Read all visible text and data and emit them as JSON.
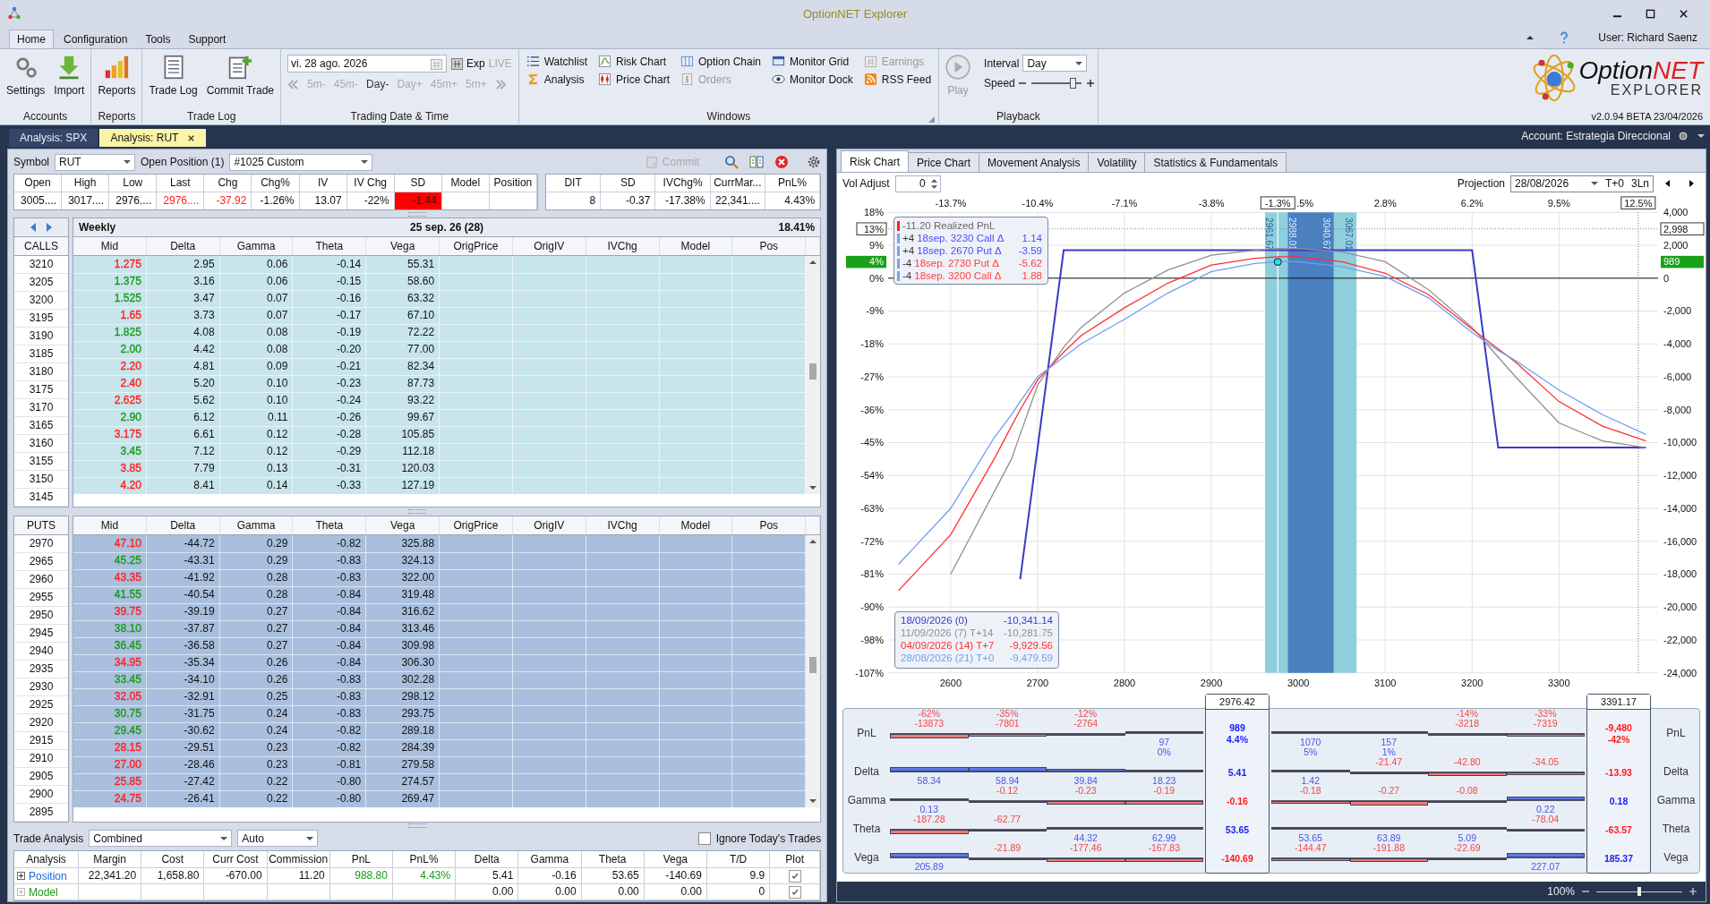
{
  "window": {
    "title": "OptionNET Explorer"
  },
  "menu_tabs": [
    {
      "label": "Home",
      "selected": true
    },
    {
      "label": "Configuration",
      "selected": false
    },
    {
      "label": "Tools",
      "selected": false
    },
    {
      "label": "Support",
      "selected": false
    }
  ],
  "user": "User: Richard Saenz",
  "ribbon": {
    "groups": [
      {
        "title": "Accounts",
        "kind": "large",
        "buttons": [
          {
            "label": "Settings",
            "kind": "gears",
            "disabled": false
          },
          {
            "label": "Import",
            "kind": "import",
            "disabled": false
          }
        ]
      },
      {
        "title": "Reports",
        "kind": "large",
        "buttons": [
          {
            "label": "Reports",
            "kind": "bars",
            "disabled": false
          }
        ]
      },
      {
        "title": "Trade Log",
        "kind": "large",
        "buttons": [
          {
            "label": "Trade Log",
            "kind": "document",
            "disabled": false
          },
          {
            "label": "Commit Trade",
            "kind": "document-plus",
            "disabled": false
          }
        ]
      },
      {
        "title": "Trading Date & Time",
        "kind": "date",
        "date": "vi. 28 ago. 2026",
        "exp": "Exp",
        "live": {
          "label": "LIVE",
          "on": false
        },
        "steps": [
          {
            "label": "5m-",
            "disabled": true
          },
          {
            "label": "45m-",
            "disabled": true
          },
          {
            "label": "Day-",
            "disabled": false
          },
          {
            "label": "Day+",
            "disabled": true
          },
          {
            "label": "45m+",
            "disabled": true
          },
          {
            "label": "5m+",
            "disabled": true
          }
        ]
      },
      {
        "title": "Windows",
        "kind": "small",
        "buttons": [
          {
            "label": "Watchlist",
            "kind": "list",
            "disabled": false
          },
          {
            "label": "Risk Chart",
            "kind": "line-chart",
            "disabled": false
          },
          {
            "label": "Option Chain",
            "kind": "columns",
            "disabled": false
          },
          {
            "label": "Monitor Grid",
            "kind": "monitor",
            "disabled": false
          },
          {
            "label": "Earnings",
            "kind": "calendar",
            "disabled": true
          },
          {
            "label": "Analysis",
            "kind": "sigma",
            "disabled": false
          },
          {
            "label": "Price Chart",
            "kind": "candle",
            "disabled": false
          },
          {
            "label": "Orders",
            "kind": "dollar",
            "disabled": true
          },
          {
            "label": "Monitor Dock",
            "kind": "eye",
            "disabled": false
          },
          {
            "label": "RSS Feed",
            "kind": "rss",
            "disabled": false
          }
        ]
      },
      {
        "title": "Playback",
        "kind": "playback",
        "play": {
          "label": "Play",
          "disabled": true
        },
        "interval_label": "Interval",
        "interval": "Day",
        "speed_label": "Speed",
        "speed": {
          "level": 0.85
        }
      }
    ],
    "logo": {
      "first": "Option",
      "second": "NET",
      "sub": "EXPLORER"
    },
    "version": "v2.0.94 BETA 23/04/2026"
  },
  "doc_tabs": [
    {
      "label": "Analysis: SPX",
      "selected": false
    },
    {
      "label": "Analysis: RUT",
      "selected": true
    }
  ],
  "account": "Account: Estrategia Direccional",
  "left": {
    "symbol_label": "Symbol",
    "symbol": "RUT",
    "position_label": "Open Position (1)",
    "position": "#1025 Custom",
    "commit": {
      "label": "Commit",
      "disabled": true
    },
    "quote": [
      {
        "label": "Open",
        "value": "3005....",
        "kind": "normal"
      },
      {
        "label": "High",
        "value": "3017....",
        "kind": "normal"
      },
      {
        "label": "Low",
        "value": "2976....",
        "kind": "normal"
      },
      {
        "label": "Last",
        "value": "2976....",
        "kind": "negative"
      },
      {
        "label": "Chg",
        "value": "-37.92",
        "kind": "negative"
      },
      {
        "label": "Chg%",
        "value": "-1.26%",
        "kind": "normal"
      },
      {
        "label": "IV",
        "value": "13.07",
        "kind": "normal"
      },
      {
        "label": "IV Chg",
        "value": "-22%",
        "kind": "normal"
      },
      {
        "label": "SD",
        "value": "-1.44",
        "kind": "alert"
      },
      {
        "label": "Model",
        "kind": "normal"
      },
      {
        "label": "Position",
        "kind": "normal"
      }
    ],
    "stats": [
      {
        "label": "DIT",
        "value": "8"
      },
      {
        "label": "SD",
        "value": "-0.37"
      },
      {
        "label": "IVChg%",
        "value": "-17.38%"
      },
      {
        "label": "CurrMar...",
        "value": "22,341...."
      },
      {
        "label": "PnL%",
        "value": "4.43%"
      }
    ],
    "chain": {
      "series": "Weekly",
      "expiry": "25 sep. 26 (28)",
      "iv": "18.41%",
      "calls": {
        "label": "CALLS",
        "columns": [
          "Mid",
          "Delta",
          "Gamma",
          "Theta",
          "Vega",
          "OrigPrice",
          "OrigIV",
          "IVChg",
          "Model",
          "Pos"
        ],
        "rows": [
          {
            "strike": "3210",
            "mid": "1.275",
            "color": "#ff2020",
            "delta": "2.95",
            "gamma": "0.06",
            "theta": "-0.14",
            "vega": "55.31"
          },
          {
            "strike": "3205",
            "mid": "1.375",
            "color": "#1a9a1a",
            "delta": "3.16",
            "gamma": "0.06",
            "theta": "-0.15",
            "vega": "58.60"
          },
          {
            "strike": "3200",
            "mid": "1.525",
            "color": "#1a9a1a",
            "delta": "3.47",
            "gamma": "0.07",
            "theta": "-0.16",
            "vega": "63.32"
          },
          {
            "strike": "3195",
            "mid": "1.65",
            "color": "#ff2020",
            "delta": "3.73",
            "gamma": "0.07",
            "theta": "-0.17",
            "vega": "67.10"
          },
          {
            "strike": "3190",
            "mid": "1.825",
            "color": "#1a9a1a",
            "delta": "4.08",
            "gamma": "0.08",
            "theta": "-0.19",
            "vega": "72.22"
          },
          {
            "strike": "3185",
            "mid": "2.00",
            "color": "#1a9a1a",
            "delta": "4.42",
            "gamma": "0.08",
            "theta": "-0.20",
            "vega": "77.00"
          },
          {
            "strike": "3180",
            "mid": "2.20",
            "color": "#ff2020",
            "delta": "4.81",
            "gamma": "0.09",
            "theta": "-0.21",
            "vega": "82.34"
          },
          {
            "strike": "3175",
            "mid": "2.40",
            "color": "#ff2020",
            "delta": "5.20",
            "gamma": "0.10",
            "theta": "-0.23",
            "vega": "87.73"
          },
          {
            "strike": "3170",
            "mid": "2.625",
            "color": "#ff2020",
            "delta": "5.62",
            "gamma": "0.10",
            "theta": "-0.24",
            "vega": "93.22"
          },
          {
            "strike": "3165",
            "mid": "2.90",
            "color": "#1a9a1a",
            "delta": "6.12",
            "gamma": "0.11",
            "theta": "-0.26",
            "vega": "99.67"
          },
          {
            "strike": "3160",
            "mid": "3.175",
            "color": "#ff2020",
            "delta": "6.61",
            "gamma": "0.12",
            "theta": "-0.28",
            "vega": "105.85"
          },
          {
            "strike": "3155",
            "mid": "3.45",
            "color": "#1a9a1a",
            "delta": "7.12",
            "gamma": "0.12",
            "theta": "-0.29",
            "vega": "112.18"
          },
          {
            "strike": "3150",
            "mid": "3.85",
            "color": "#ff2020",
            "delta": "7.79",
            "gamma": "0.13",
            "theta": "-0.31",
            "vega": "120.03"
          },
          {
            "strike": "3145",
            "mid": "4.20",
            "color": "#ff2020",
            "delta": "8.41",
            "gamma": "0.14",
            "theta": "-0.33",
            "vega": "127.19"
          }
        ]
      },
      "puts": {
        "label": "PUTS",
        "columns": [
          "Mid",
          "Delta",
          "Gamma",
          "Theta",
          "Vega",
          "OrigPrice",
          "OrigIV",
          "IVChg",
          "Model",
          "Pos"
        ],
        "rows": [
          {
            "strike": "2970",
            "mid": "47.10",
            "color": "#ff2020",
            "delta": "-44.72",
            "gamma": "0.29",
            "theta": "-0.82",
            "vega": "325.88"
          },
          {
            "strike": "2965",
            "mid": "45.25",
            "color": "#1a9a1a",
            "delta": "-43.31",
            "gamma": "0.29",
            "theta": "-0.83",
            "vega": "324.13"
          },
          {
            "strike": "2960",
            "mid": "43.35",
            "color": "#ff2020",
            "delta": "-41.92",
            "gamma": "0.28",
            "theta": "-0.83",
            "vega": "322.00"
          },
          {
            "strike": "2955",
            "mid": "41.55",
            "color": "#1a9a1a",
            "delta": "-40.54",
            "gamma": "0.28",
            "theta": "-0.84",
            "vega": "319.48"
          },
          {
            "strike": "2950",
            "mid": "39.75",
            "color": "#ff2020",
            "delta": "-39.19",
            "gamma": "0.27",
            "theta": "-0.84",
            "vega": "316.62"
          },
          {
            "strike": "2945",
            "mid": "38.10",
            "color": "#1a9a1a",
            "delta": "-37.87",
            "gamma": "0.27",
            "theta": "-0.84",
            "vega": "313.46"
          },
          {
            "strike": "2940",
            "mid": "36.45",
            "color": "#1a9a1a",
            "delta": "-36.58",
            "gamma": "0.27",
            "theta": "-0.84",
            "vega": "309.98"
          },
          {
            "strike": "2935",
            "mid": "34.95",
            "color": "#ff2020",
            "delta": "-35.34",
            "gamma": "0.26",
            "theta": "-0.84",
            "vega": "306.30"
          },
          {
            "strike": "2930",
            "mid": "33.45",
            "color": "#1a9a1a",
            "delta": "-34.10",
            "gamma": "0.26",
            "theta": "-0.83",
            "vega": "302.28"
          },
          {
            "strike": "2925",
            "mid": "32.05",
            "color": "#ff2020",
            "delta": "-32.91",
            "gamma": "0.25",
            "theta": "-0.83",
            "vega": "298.12"
          },
          {
            "strike": "2920",
            "mid": "30.75",
            "color": "#1a9a1a",
            "delta": "-31.75",
            "gamma": "0.24",
            "theta": "-0.83",
            "vega": "293.75"
          },
          {
            "strike": "2915",
            "mid": "29.45",
            "color": "#1a9a1a",
            "delta": "-30.62",
            "gamma": "0.24",
            "theta": "-0.82",
            "vega": "289.18"
          },
          {
            "strike": "2910",
            "mid": "28.15",
            "color": "#ff2020",
            "delta": "-29.51",
            "gamma": "0.23",
            "theta": "-0.82",
            "vega": "284.39"
          },
          {
            "strike": "2905",
            "mid": "27.00",
            "color": "#ff2020",
            "delta": "-28.46",
            "gamma": "0.23",
            "theta": "-0.81",
            "vega": "279.58"
          },
          {
            "strike": "2900",
            "mid": "25.85",
            "color": "#ff2020",
            "delta": "-27.42",
            "gamma": "0.22",
            "theta": "-0.80",
            "vega": "274.57"
          },
          {
            "strike": "2895",
            "mid": "24.75",
            "color": "#ff2020",
            "delta": "-26.41",
            "gamma": "0.22",
            "theta": "-0.80",
            "vega": "269.47"
          }
        ]
      }
    },
    "trade_analysis": {
      "label": "Trade Analysis",
      "mode": "Combined",
      "scale": "Auto",
      "ignore": {
        "label": "Ignore Today's Trades",
        "checked": false
      },
      "columns": [
        "Analysis",
        "Margin",
        "Cost",
        "Curr Cost",
        "Commission",
        "PnL",
        "PnL%",
        "Delta",
        "Gamma",
        "Theta",
        "Vega",
        "T/D",
        "Plot"
      ],
      "rows": [
        {
          "color": "#1a6ad0",
          "cells": [
            "Position",
            "22,341.20",
            "1,658.80",
            "-670.00",
            "11.20",
            "988.80",
            "4.43%",
            "5.41",
            "-0.16",
            "53.65",
            "-140.69",
            "9.9"
          ],
          "plot": true
        },
        {
          "color": "#1a9a1a",
          "cells": [
            "Model",
            null,
            null,
            null,
            null,
            null,
            null,
            "0.00",
            "0.00",
            "0.00",
            "0.00",
            "0"
          ],
          "plot": true
        }
      ]
    }
  },
  "right": {
    "chart_tabs": [
      {
        "label": "Risk Chart",
        "selected": true
      },
      {
        "label": "Price Chart",
        "selected": false
      },
      {
        "label": "Movement Analysis",
        "selected": false
      },
      {
        "label": "Volatility",
        "selected": false
      },
      {
        "label": "Statistics & Fundamentals",
        "selected": false
      }
    ],
    "vol_adjust": {
      "label": "Vol Adjust",
      "value": "0"
    },
    "projection": {
      "label": "Projection",
      "date": "28/08/2026",
      "offset": "T+0",
      "lines": "3Ln"
    },
    "risk_chart": {
      "top_axis_labels": [
        "-13.7%",
        "-10.4%",
        "-7.1%",
        "-3.8%",
        ".5%",
        "2.8%",
        "6.2%",
        "9.5%"
      ],
      "percent_ticks": [
        "18%",
        "9%",
        "0%",
        "-9%",
        "-18%",
        "-27%",
        "-36%",
        "-45%",
        "-54%",
        "-63%",
        "-72%",
        "-81%",
        "-90%",
        "-98%",
        "-107%"
      ],
      "current_pnl": {
        "percent": "4%",
        "value": "989"
      },
      "level_percent": "13%",
      "cursor_percents": [
        "-1.3%",
        "12.5%"
      ],
      "band_labels": [
        "2961.67",
        "2988.01",
        "3040.67",
        "3067.01"
      ],
      "legend": {
        "realized": "-11.20 Realized PnL",
        "legs": [
          {
            "qty": "+4",
            "name": "18sep. 3230 Call Δ",
            "delta": "1.14",
            "color": "#4a4aff"
          },
          {
            "qty": "+4",
            "name": "18sep. 2670 Put Δ",
            "delta": "-3.59",
            "color": "#4a4aff"
          },
          {
            "qty": "-4",
            "name": "18sep. 2730 Put Δ",
            "delta": "-5.62",
            "color": "#ff4040"
          },
          {
            "qty": "-4",
            "name": "18sep. 3200 Call Δ",
            "delta": "1.88",
            "color": "#ff4040"
          }
        ]
      },
      "tooltip": [
        {
          "value": "-10,341.14"
        },
        {
          "value": "-10,281.75"
        },
        {
          "value": "-9,929.56"
        },
        {
          "value": "-9,479.59"
        }
      ],
      "chart_data": {
        "type": "line",
        "grid": true,
        "x": [
          2540,
          2600,
          2650,
          2670,
          2680,
          2700,
          2730,
          2750,
          2800,
          2850,
          2900,
          2950,
          2976,
          3000,
          3050,
          3100,
          3150,
          3200,
          3230,
          3250,
          3300,
          3350,
          3400
        ],
        "xlim": [
          2528,
          3414
        ],
        "ylim": [
          -24000,
          4000
        ],
        "bands": [
          {
            "axis": "x",
            "from": 2961.67,
            "to": 3067.01
          },
          {
            "axis": "x",
            "from": 2988.01,
            "to": 3040.67
          }
        ],
        "ref_lines": [
          {
            "axis": "y",
            "value": 2998,
            "label": "2,998"
          },
          {
            "axis": "x",
            "value": 2976.42,
            "label": "2976.42"
          },
          {
            "axis": "x",
            "value": 3391.17,
            "label": "3391.17"
          }
        ],
        "xticks": [
          2600,
          2700,
          2800,
          2900,
          3000,
          3100,
          3200,
          3300
        ],
        "yticks": [
          {
            "value": 4000,
            "label": "4,000"
          },
          {
            "value": 2000,
            "label": "2,000"
          },
          {
            "value": 0,
            "label": "0"
          },
          {
            "value": -2000,
            "label": "-2,000"
          },
          {
            "value": -4000,
            "label": "-4,000"
          },
          {
            "value": -6000,
            "label": "-6,000"
          },
          {
            "value": -8000,
            "label": "-8,000"
          },
          {
            "value": -10000,
            "label": "-10,000"
          },
          {
            "value": -12000,
            "label": "-12,000"
          },
          {
            "value": -14000,
            "label": "-14,000"
          },
          {
            "value": -16000,
            "label": "-16,000"
          },
          {
            "value": -18000,
            "label": "-18,000"
          },
          {
            "value": -20000,
            "label": "-20,000"
          },
          {
            "value": -22000,
            "label": "-22,000"
          },
          {
            "value": -24000,
            "label": "-24,000"
          }
        ],
        "series": [
          {
            "name": "18/09/2026 (0)",
            "color": "#3a3ac8",
            "values": [
              null,
              null,
              null,
              null,
              -18300,
              -10300,
              1700,
              1700,
              1700,
              1700,
              1700,
              1700,
              1700,
              1700,
              1700,
              1700,
              1700,
              1700,
              -10300,
              -10300,
              -10300,
              -10300,
              -10300
            ]
          },
          {
            "name": "11/09/2026 (7) T+14",
            "color": "#909090",
            "values": [
              null,
              -18000,
              -13000,
              -11000,
              -9500,
              -6500,
              -4200,
              -3000,
              -900,
              500,
              1400,
              1700,
              1800,
              1800,
              1600,
              1000,
              -700,
              -3000,
              -4800,
              -6000,
              -8800,
              -9900,
              -10300
            ]
          },
          {
            "name": "04/09/2026 (14) T+7",
            "color": "#ff3030",
            "values": [
              -19000,
              -15600,
              -11000,
              -9000,
              -8000,
              -6200,
              -4500,
              -3500,
              -1800,
              -300,
              800,
              1200,
              1300,
              1300,
              1000,
              300,
              -1000,
              -3100,
              -4300,
              -5100,
              -7500,
              -9000,
              -9900
            ]
          },
          {
            "name": "28/08/2026 (21) T+0",
            "color": "#6f9ff0",
            "values": [
              -17400,
              -14000,
              -9700,
              -8300,
              -7500,
              -6000,
              -4800,
              -4000,
              -2500,
              -900,
              400,
              900,
              1000,
              1000,
              700,
              100,
              -1200,
              -3300,
              -4400,
              -5000,
              -6800,
              -8300,
              -9500
            ]
          }
        ]
      }
    },
    "greeks": {
      "left_labels": [
        "PnL",
        "Delta",
        "Gamma",
        "Theta",
        "Vega"
      ],
      "right_labels": [
        "PnL",
        "Delta",
        "Gamma",
        "Theta",
        "Vega"
      ],
      "columns": [
        {
          "kind": "bucket",
          "pnl": "-13873",
          "pnl_pct": "-62%",
          "delta": "58.34",
          "gamma": "0.13",
          "theta": "-187.28",
          "vega": "205.89"
        },
        {
          "kind": "bucket",
          "pnl": "-7801",
          "pnl_pct": "-35%",
          "delta": "58.94",
          "gamma": "-0.12",
          "theta": "-62.77",
          "vega": "-21.89"
        },
        {
          "kind": "bucket",
          "pnl": "-2764",
          "pnl_pct": "-12%",
          "delta": "39.84",
          "gamma": "-0.23",
          "theta": "44.32",
          "vega": "-177.46"
        },
        {
          "kind": "bucket",
          "pnl": "97",
          "pnl_pct": "0%",
          "delta": "18.23",
          "gamma": "-0.19",
          "theta": "62.99",
          "vega": "-167.83"
        },
        {
          "kind": "cursor",
          "pnl": "989",
          "pnl_pct": "4.4%",
          "delta": "5.41",
          "gamma": "-0.16",
          "theta": "53.65",
          "vega": "-140.69"
        },
        {
          "kind": "bucket",
          "pnl": "1070",
          "pnl_pct": "5%",
          "delta": "1.42",
          "gamma": "-0.18",
          "theta": "53.65",
          "vega": "-144.47"
        },
        {
          "kind": "bucket",
          "pnl": "157",
          "pnl_pct": "1%",
          "delta": "-21.47",
          "gamma": "-0.27",
          "theta": "63.89",
          "vega": "-191.88"
        },
        {
          "kind": "bucket",
          "pnl": "-3218",
          "pnl_pct": "-14%",
          "delta": "-42.80",
          "gamma": "-0.08",
          "theta": "5.09",
          "vega": "-22.69"
        },
        {
          "kind": "bucket",
          "pnl": "-7319",
          "pnl_pct": "-33%",
          "delta": "-34.05",
          "gamma": "0.22",
          "theta": "-78.04",
          "vega": "227.07"
        },
        {
          "kind": "cursor",
          "pnl": "-9,480",
          "pnl_pct": "-42%",
          "delta": "-13.93",
          "gamma": "0.18",
          "theta": "-63.57",
          "vega": "185.37"
        }
      ]
    },
    "zoom": {
      "label": "100%",
      "level": 0.5
    }
  }
}
